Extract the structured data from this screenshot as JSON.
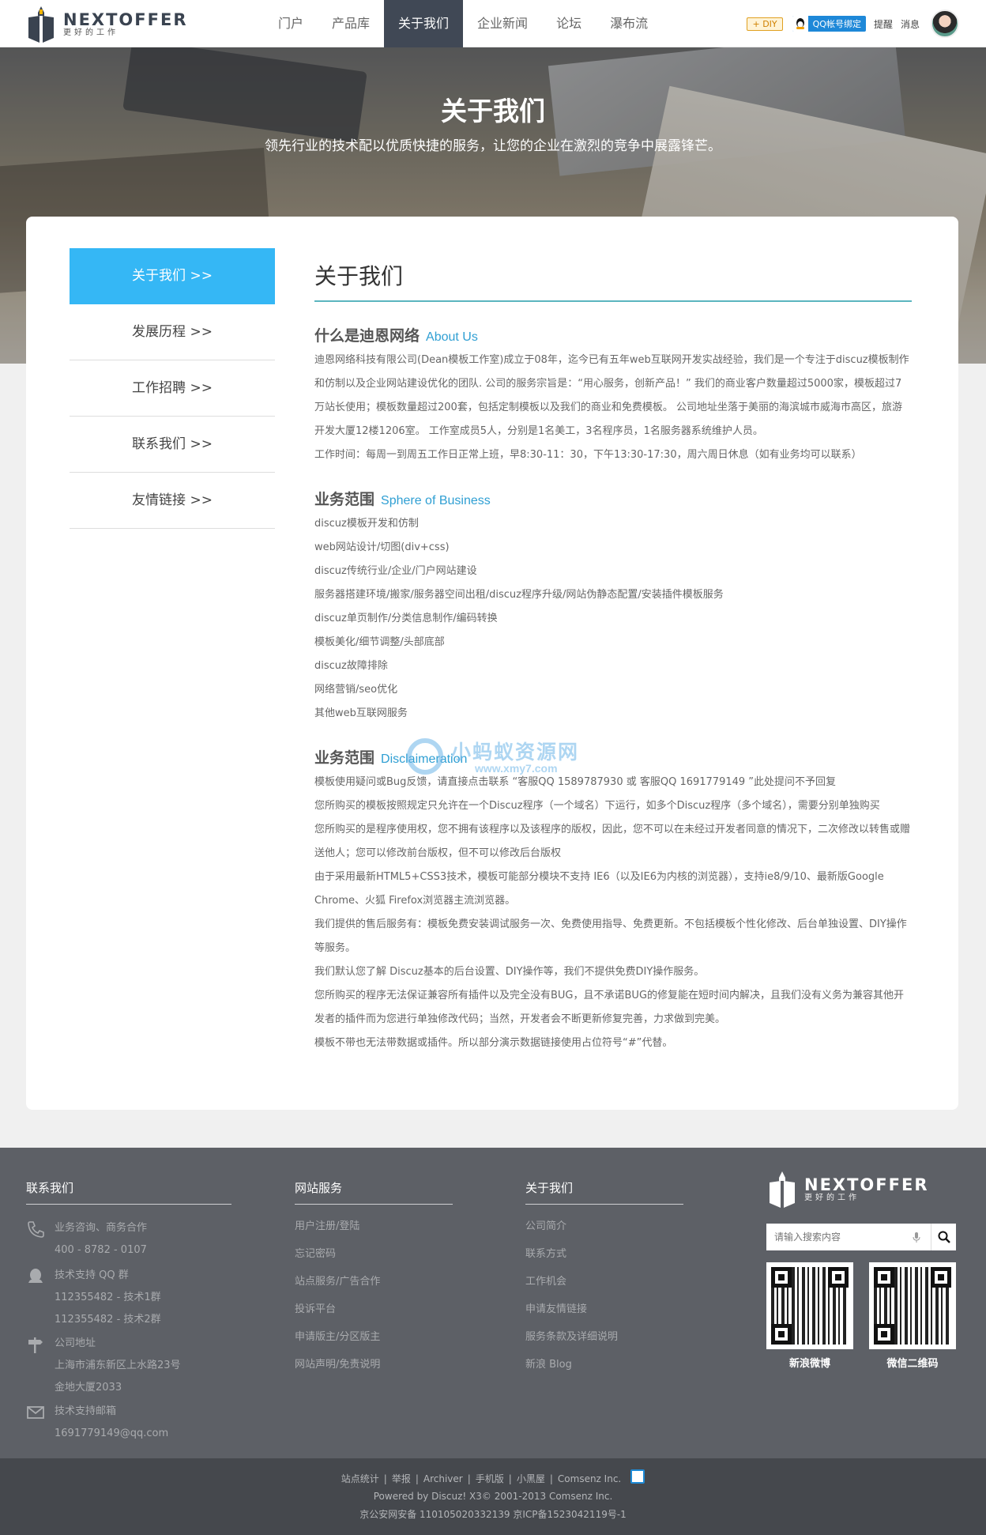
{
  "header": {
    "logo_name": "NEXTOFFER",
    "logo_sub": "更好的工作",
    "nav": [
      {
        "label": "门户",
        "active": false
      },
      {
        "label": "产品库",
        "active": false
      },
      {
        "label": "关于我们",
        "active": true
      },
      {
        "label": "企业新闻",
        "active": false
      },
      {
        "label": "论坛",
        "active": false
      },
      {
        "label": "瀑布流",
        "active": false
      }
    ],
    "diy": "DIY",
    "qq_bind": "QQ帐号绑定",
    "remind": "提醒",
    "messages": "消息"
  },
  "banner": {
    "title": "关于我们",
    "subtitle": "领先行业的技术配以优质快捷的服务，让您的企业在激烈的竞争中展露锋芒。"
  },
  "sidebar": {
    "items": [
      {
        "label": "关于我们  >>",
        "active": true
      },
      {
        "label": "发展历程  >>",
        "active": false
      },
      {
        "label": "工作招聘  >>",
        "active": false
      },
      {
        "label": "联系我们  >>",
        "active": false
      },
      {
        "label": "友情链接  >>",
        "active": false
      }
    ]
  },
  "content": {
    "title": "关于我们",
    "sec1": {
      "title": "什么是迪恩网络",
      "en": "About Us",
      "para1": "迪恩网络科技有限公司(Dean模板工作室)成立于08年，迄今已有五年web互联网开发实战经验，我们是一个专注于discuz模板制作和仿制以及企业网站建设优化的团队. 公司的服务宗旨是：“用心服务，创新产品！” 我们的商业客户数量超过5000家，模板超过7万站长使用；模板数量超过200套，包括定制模板以及我们的商业和免费模板。 公司地址坐落于美丽的海滨城市威海市高区，旅游开发大厦12楼1206室。 工作室成员5人，分别是1名美工，3名程序员，1名服务器系统维护人员。",
      "para2": "工作时间：每周一到周五工作日正常上班，早8:30-11：30，下午13:30-17:30，周六周日休息（如有业务均可以联系）"
    },
    "sec2": {
      "title": "业务范围",
      "en": "Sphere of Business",
      "items": [
        "discuz模板开发和仿制",
        "web网站设计/切图(div+css)",
        "discuz传统行业/企业/门户网站建设",
        "服务器搭建环境/搬家/服务器空间出租/discuz程序升级/网站伪静态配置/安装插件模板服务",
        "discuz单页制作/分类信息制作/编码转换",
        "模板美化/细节调整/头部底部",
        "discuz故障排除",
        "网络营销/seo优化",
        "其他web互联网服务"
      ]
    },
    "sec3": {
      "title": "业务范围",
      "en": "Disclaimeration",
      "items": [
        "模板使用疑问或Bug反馈，请直接点击联系 “客服QQ 1589787930 或 客服QQ 1691779149 ”此处提问不予回复",
        "您所购买的模板按照规定只允许在一个Discuz程序（一个域名）下运行，如多个Discuz程序（多个域名），需要分别单独购买",
        "您所购买的是程序使用权，您不拥有该程序以及该程序的版权，因此，您不可以在未经过开发者同意的情况下，二次修改以转售或赠送他人；您可以修改前台版权，但不可以修改后台版权",
        "由于采用最新HTML5+CSS3技术，模板可能部分模块不支持 IE6（以及IE6为内核的浏览器），支持ie8/9/10、最新版Google Chrome、火狐 Firefox浏览器主流浏览器。",
        "我们提供的售后服务有：模板免费安装调试服务一次、免费使用指导、免费更新。不包括模板个性化修改、后台单独设置、DIY操作等服务。",
        "我们默认您了解 Discuz基本的后台设置、DIY操作等，我们不提供免费DIY操作服务。",
        "您所购买的程序无法保证兼容所有插件以及完全没有BUG，且不承诺BUG的修复能在短时间内解决，且我们没有义务为兼容其他开发者的插件而为您进行单独修改代码；当然，开发者会不断更新修复完善，力求做到完美。",
        "模板不带也无法带数据或插件。所以部分演示数据链接使用占位符号“#”代替。"
      ]
    }
  },
  "watermark": {
    "cn": "小蚂蚁资源网",
    "url": "www.xmy7.com"
  },
  "footer": {
    "contact": {
      "title": "联系我们",
      "biz_label": "业务咨询、商务合作",
      "phone": "400 - 8782 - 0107",
      "qq_label": "技术支持 QQ 群",
      "qq1": "112355482 - 技术1群",
      "qq2": "112355482 - 技术2群",
      "addr_label": "公司地址",
      "addr1": "上海市浦东新区上水路23号",
      "addr2": "金地大厦2033",
      "mail_label": "技术支持邮箱",
      "mail": "1691779149@qq.com"
    },
    "service": {
      "title": "网站服务",
      "links": [
        "用户注册/登陆",
        "忘记密码",
        "站点服务/广告合作",
        "投诉平台",
        "申请版主/分区版主",
        "网站声明/免责说明"
      ]
    },
    "about": {
      "title": "关于我们",
      "links": [
        "公司简介",
        "联系方式",
        "工作机会",
        "申请友情链接",
        "服务条款及详细说明",
        "新浪 Blog"
      ]
    },
    "logo_name": "NEXTOFFER",
    "logo_sub": "更好的工作",
    "search_placeholder": "请输入搜索内容",
    "qr1_label": "新浪微博",
    "qr2_label": "微信二维码"
  },
  "bottom": {
    "links": [
      "站点统计",
      "举报",
      "Archiver",
      "手机版",
      "小黑屋",
      "Comsenz Inc."
    ],
    "powered": "Powered by Discuz! X3© 2001-2013 Comsenz Inc.",
    "icp": "京公安网安备 11010502033213​9 京ICP备1523042119号-1"
  }
}
